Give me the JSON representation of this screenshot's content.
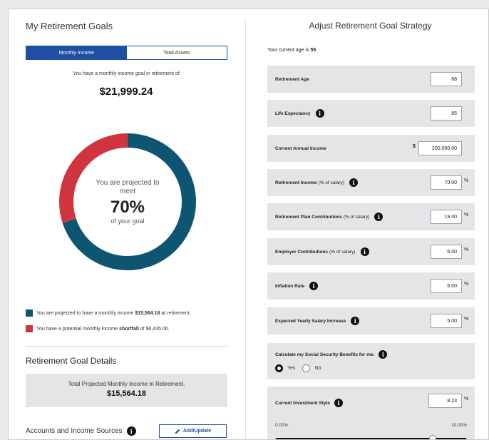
{
  "left": {
    "title": "My Retirement Goals",
    "tabs": [
      {
        "label": "Monthly Income",
        "active": true
      },
      {
        "label": "Total Assets",
        "active": false
      }
    ],
    "goal_text": "You have a monthly income goal in retirement of",
    "goal_amount": "$21,999.24",
    "projection": {
      "line1": "You are projected to meet",
      "percent_label": "70%",
      "line2": "of your goal",
      "percent": 70
    },
    "legend": [
      {
        "pre": "You are projected to have a monthly income",
        "value": "$15,564.18",
        "post": "at retirement.",
        "color": "#0e5572"
      },
      {
        "pre": "You have a potential monthly income",
        "value": "shortfall",
        "post": "of $6,435.06.",
        "color": "#d0353f"
      }
    ],
    "details_title": "Retirement Goal Details",
    "total_label": "Total Projected Monthly Income in Retirement.",
    "total_amount": "$15,564.18",
    "accounts_label": "Accounts and Income Sources",
    "add_button": "Add/Update"
  },
  "right": {
    "title": "Adjust Retirement Goal Strategy",
    "age_prefix": "Your current age is",
    "age_value": "55",
    "rows": [
      {
        "label": "Retirement Age",
        "note": "",
        "value": "68",
        "unit": "",
        "info": false
      },
      {
        "label": "Life Expectancy",
        "note": "",
        "value": "85",
        "unit": "",
        "info": true
      },
      {
        "label": "Current Annual Income",
        "note": "",
        "value": "200,000.00",
        "unit": "",
        "prefix": "$",
        "info": false
      },
      {
        "label": "Retirement Income",
        "note": "(% of salary)",
        "value": "70.00",
        "unit": "%",
        "info": true
      },
      {
        "label": "Retirement Plan Contributions",
        "note": "(% of salary)",
        "value": "19.00",
        "unit": "%",
        "info": true
      },
      {
        "label": "Employer Contributions",
        "note": "(% of salary)",
        "value": "6.00",
        "unit": "%",
        "info": true
      },
      {
        "label": "Inflation Rate",
        "note": "",
        "value": "6.00",
        "unit": "%",
        "info": true
      },
      {
        "label": "Expected Yearly Salary Increase",
        "note": "",
        "value": "5.00",
        "unit": "%",
        "info": true
      }
    ],
    "social_security": {
      "label": "Calculate my Social Security Benefits for me.",
      "options": [
        "Yes",
        "No"
      ],
      "selected": "Yes"
    },
    "investment": {
      "label": "Current Investment Style",
      "value": "8.23",
      "unit": "%",
      "min_label": "0.00%",
      "max_label": "10.00%",
      "min": 0,
      "max": 10,
      "current": 8.23
    }
  },
  "colors": {
    "accent": "#1e4fa3",
    "projected": "#0e5572",
    "shortfall": "#d0353f",
    "panel_gray": "#e4e5e7"
  }
}
